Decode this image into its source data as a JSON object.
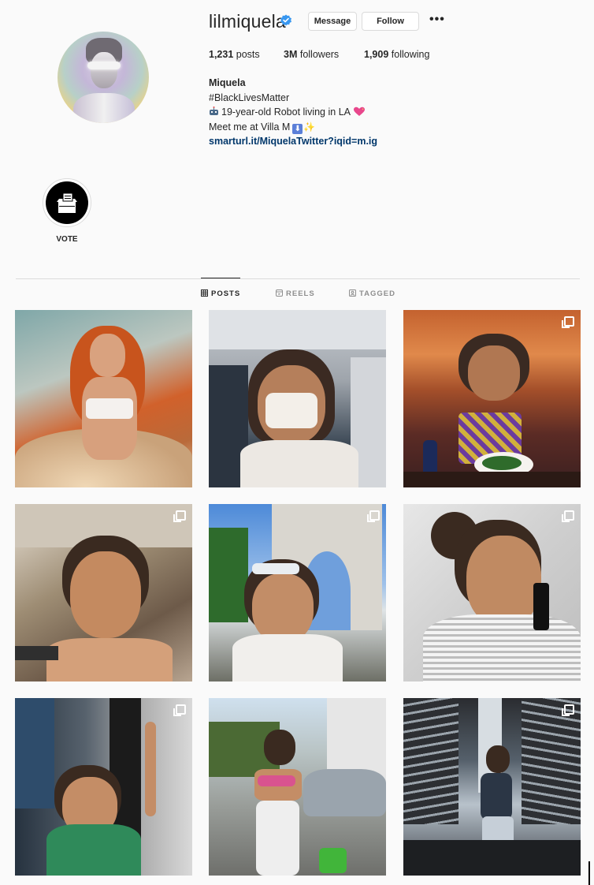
{
  "profile": {
    "username": "lilmiquela",
    "message_label": "Message",
    "follow_label": "Follow",
    "more_label": "•••",
    "stats": {
      "posts_count": "1,231",
      "posts_label": "posts",
      "followers_count": "3M",
      "followers_label": "followers",
      "following_count": "1,909",
      "following_label": "following"
    },
    "bio": {
      "full_name": "Miquela",
      "line1": "#BlackLivesMatter",
      "line2": "19-year-old Robot living in LA",
      "line3": "Meet me at Villa M",
      "link": "smarturl.it/MiquelaTwitter?iqid=m.ig"
    }
  },
  "highlights": [
    {
      "label": "VOTE",
      "icon": "ballot-box-icon"
    }
  ],
  "tabs": [
    {
      "label": "POSTS",
      "icon": "grid-icon",
      "active": true
    },
    {
      "label": "REELS",
      "icon": "reels-icon",
      "active": false
    },
    {
      "label": "TAGGED",
      "icon": "tagged-icon",
      "active": false
    }
  ],
  "posts_grid": [
    {
      "multi": false
    },
    {
      "multi": false
    },
    {
      "multi": true
    },
    {
      "multi": true
    },
    {
      "multi": true
    },
    {
      "multi": true
    },
    {
      "multi": true
    },
    {
      "multi": false
    },
    {
      "multi": true
    }
  ],
  "colors": {
    "link": "#00376b",
    "verified": "#3897f0",
    "text": "#262626",
    "muted": "#8e8e8e",
    "border": "#dbdbdb"
  }
}
